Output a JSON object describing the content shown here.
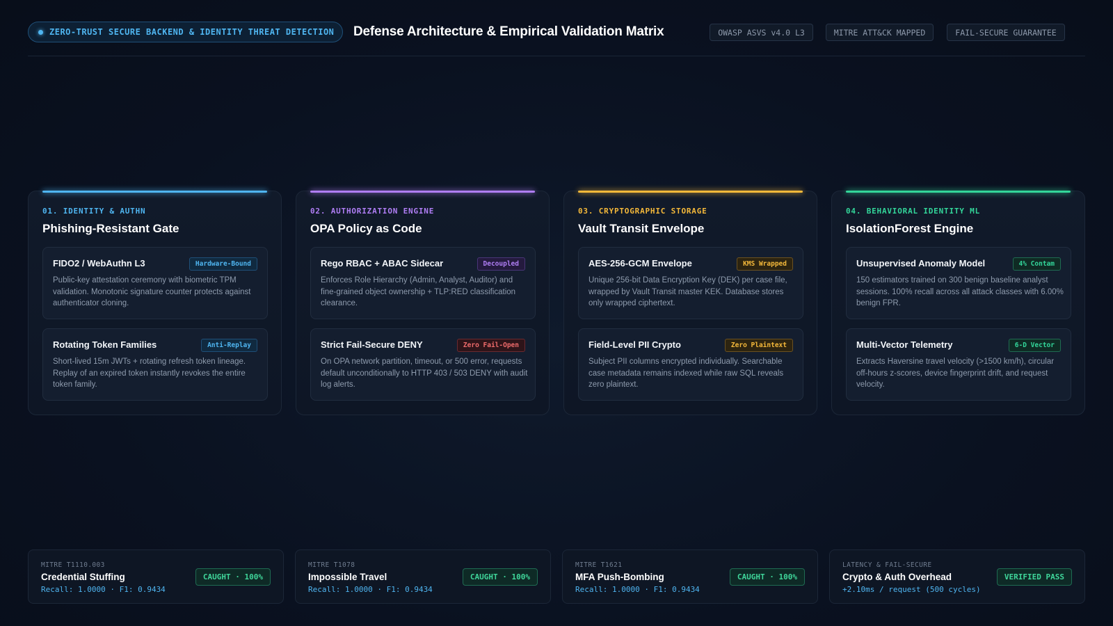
{
  "header": {
    "pill_label": "ZERO-TRUST SECURE BACKEND & IDENTITY THREAT DETECTION",
    "title": "Defense Architecture & Empirical Validation Matrix",
    "tags": [
      "OWASP ASVS v4.0 L3",
      "MITRE ATT&CK MAPPED",
      "FAIL-SECURE GUARANTEE"
    ]
  },
  "colors": {
    "blue": "#4fb5f0",
    "purple": "#b07ef5",
    "amber": "#f5b93a",
    "green": "#33d69a",
    "red": "#ef6b6b"
  },
  "cards": [
    {
      "kicker": "01. IDENTITY & AUTHN",
      "title": "Phishing-Resistant Gate",
      "items": [
        {
          "title": "FIDO2 / WebAuthn L3",
          "badge": "Hardware-Bound",
          "desc": "Public-key attestation ceremony with biometric TPM validation. Monotonic signature counter protects against authenticator cloning."
        },
        {
          "title": "Rotating Token Families",
          "badge": "Anti-Replay",
          "desc": "Short-lived 15m JWTs + rotating refresh token lineage. Replay of an expired token instantly revokes the entire token family."
        }
      ]
    },
    {
      "kicker": "02. AUTHORIZATION ENGINE",
      "title": "OPA Policy as Code",
      "items": [
        {
          "title": "Rego RBAC + ABAC Sidecar",
          "badge": "Decoupled",
          "desc": "Enforces Role Hierarchy (Admin, Analyst, Auditor) and fine-grained object ownership + TLP:RED classification clearance."
        },
        {
          "title": "Strict Fail-Secure DENY",
          "badge": "Zero Fail-Open",
          "desc": "On OPA network partition, timeout, or 500 error, requests default unconditionally to HTTP 403 / 503 DENY with audit log alerts."
        }
      ]
    },
    {
      "kicker": "03. CRYPTOGRAPHIC STORAGE",
      "title": "Vault Transit Envelope",
      "items": [
        {
          "title": "AES-256-GCM Envelope",
          "badge": "KMS Wrapped",
          "desc": "Unique 256-bit Data Encryption Key (DEK) per case file, wrapped by Vault Transit master KEK. Database stores only wrapped ciphertext."
        },
        {
          "title": "Field-Level PII Crypto",
          "badge": "Zero Plaintext",
          "desc": "Subject PII columns encrypted individually. Searchable case metadata remains indexed while raw SQL reveals zero plaintext."
        }
      ]
    },
    {
      "kicker": "04. BEHAVIORAL IDENTITY ML",
      "title": "IsolationForest Engine",
      "items": [
        {
          "title": "Unsupervised Anomaly Model",
          "badge": "4% Contam",
          "desc": "150 estimators trained on 300 benign baseline analyst sessions. 100% recall across all attack classes with 6.00% benign FPR."
        },
        {
          "title": "Multi-Vector Telemetry",
          "badge": "6-D Vector",
          "desc": "Extracts Haversine travel velocity (>1500 km/h), circular off-hours z-scores, device fingerprint drift, and request velocity."
        }
      ]
    }
  ],
  "metrics": [
    {
      "kicker": "MITRE T1110.003",
      "title": "Credential Stuffing",
      "stat": "Recall: 1.0000 · F1: 0.9434",
      "badge": "CAUGHT · 100%"
    },
    {
      "kicker": "MITRE T1078",
      "title": "Impossible Travel",
      "stat": "Recall: 1.0000 · F1: 0.9434",
      "badge": "CAUGHT · 100%"
    },
    {
      "kicker": "MITRE T1621",
      "title": "MFA Push-Bombing",
      "stat": "Recall: 1.0000 · F1: 0.9434",
      "badge": "CAUGHT · 100%"
    },
    {
      "kicker": "LATENCY & FAIL-SECURE",
      "title": "Crypto & Auth Overhead",
      "stat": "+2.10ms / request (500 cycles)",
      "badge": "VERIFIED PASS"
    }
  ]
}
